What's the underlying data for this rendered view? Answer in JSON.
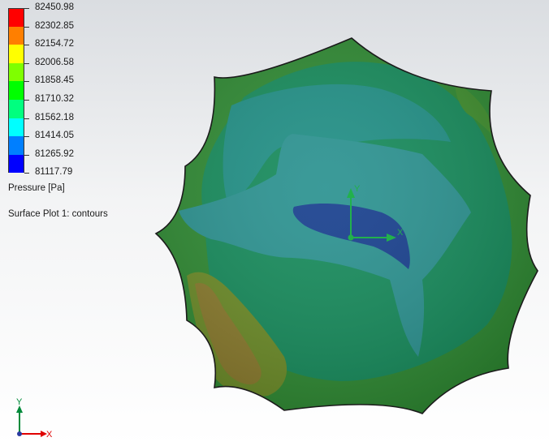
{
  "legend": {
    "values": [
      "82450.98",
      "82302.85",
      "82154.72",
      "82006.58",
      "81858.45",
      "81710.32",
      "81562.18",
      "81414.05",
      "81265.92",
      "81117.79"
    ],
    "colors": [
      "#ff0000",
      "#ff7f00",
      "#ffff00",
      "#7fff00",
      "#00ff00",
      "#00ff7f",
      "#00ffff",
      "#007fff",
      "#0000ff"
    ],
    "quantity": "Pressure [Pa]",
    "plot_name": "Surface Plot 1: contours"
  },
  "triad_center": {
    "x": "X",
    "y": "Y",
    "x_color": "#22b14c",
    "y_color": "#22b14c"
  },
  "triad_corner": {
    "x": "X",
    "y": "Y",
    "x_color": "#e00000",
    "y_color": "#008a3a"
  },
  "model_colors": {
    "edge": "#1b1b1b",
    "outer": "#2e8a32",
    "mid_green": "#138a5a",
    "teal": "#1f8e8a",
    "blue": "#17428f",
    "olive": "#6e8f24",
    "brown": "#8a7a2b"
  }
}
